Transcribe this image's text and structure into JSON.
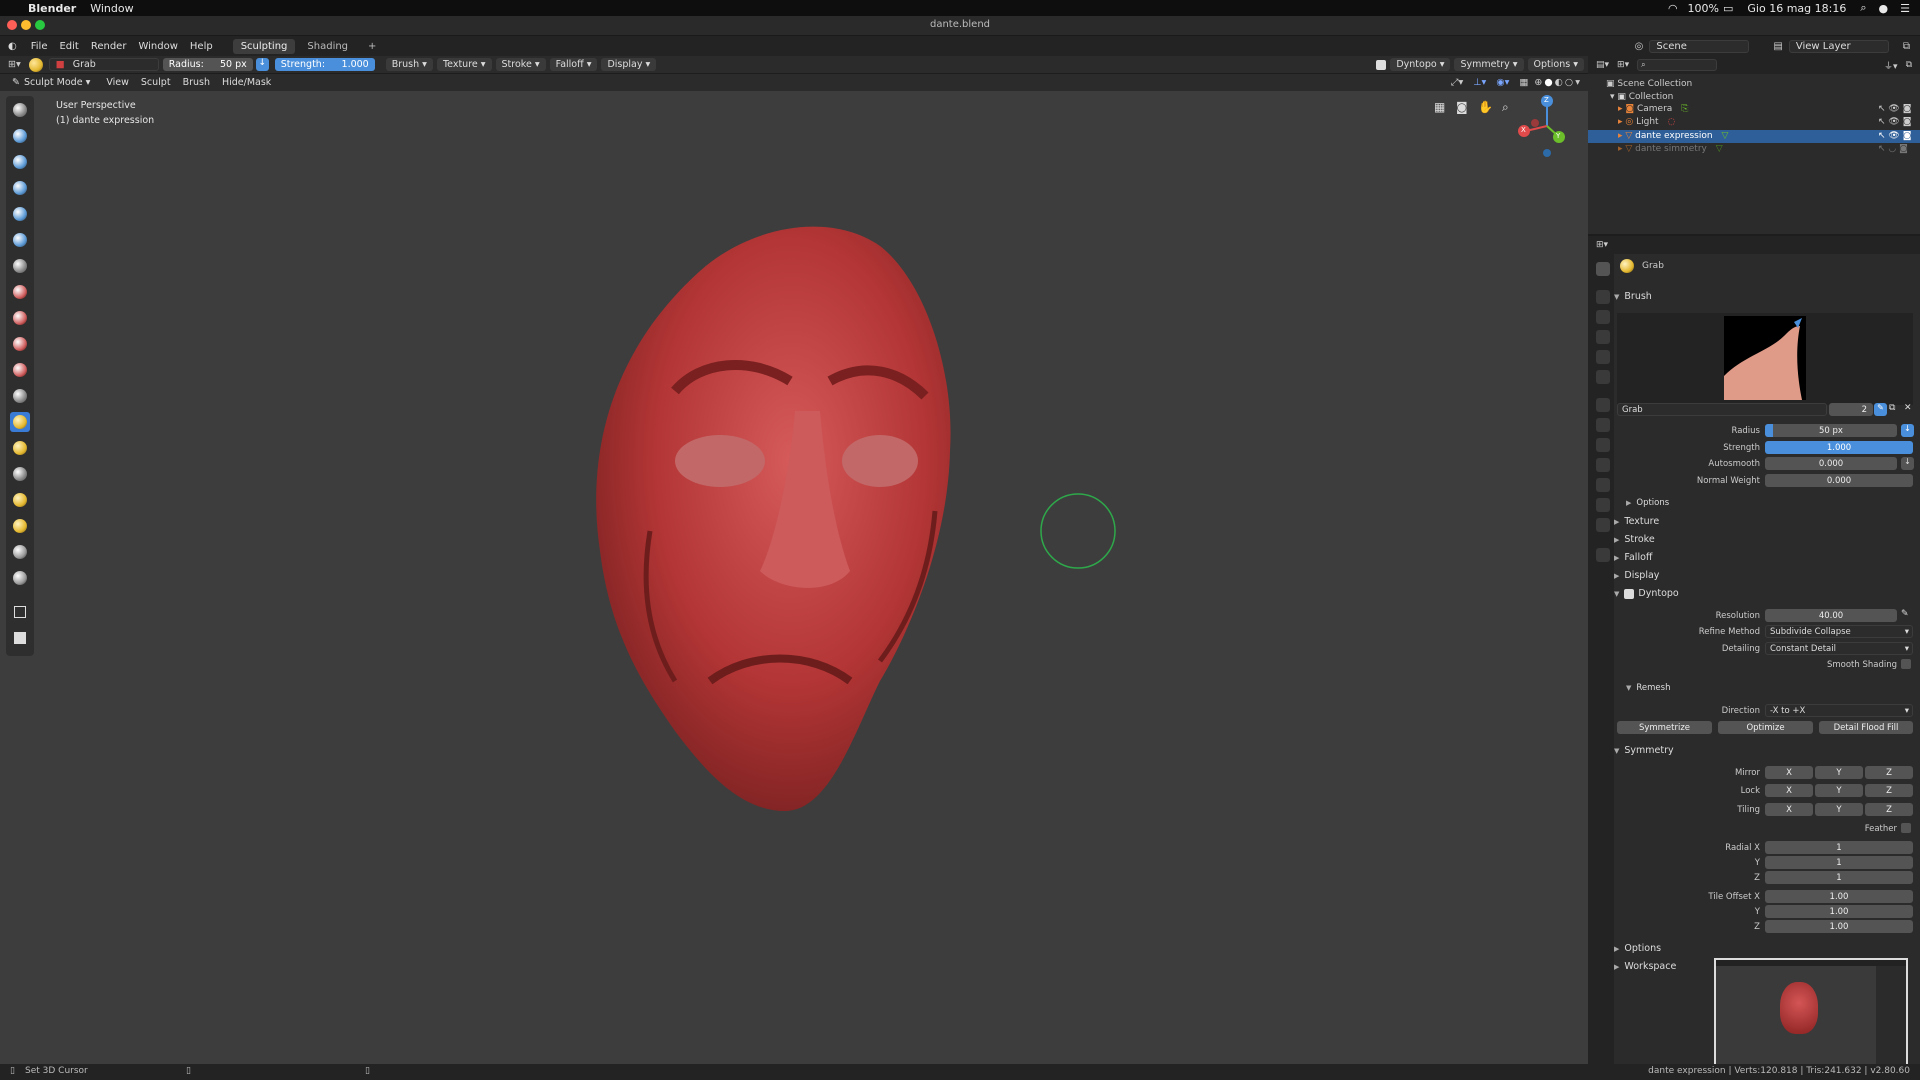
{
  "mac": {
    "app": "Blender",
    "menu": [
      "Window"
    ],
    "battery": "100%",
    "clock": "Gio 16 mag  18:16"
  },
  "window_title": "dante.blend",
  "topmenu": [
    "File",
    "Edit",
    "Render",
    "Window",
    "Help"
  ],
  "workspaces": [
    "Sculpting",
    "Shading"
  ],
  "workspace_add": "+",
  "scene": "Scene",
  "view_layer": "View Layer",
  "tool_header": {
    "brush_name": "Grab",
    "radius_label": "Radius:",
    "radius_value": "50 px",
    "strength_label": "Strength:",
    "strength_value": "1.000",
    "menus": [
      "Brush",
      "Texture",
      "Stroke",
      "Falloff",
      "Display"
    ],
    "dyntopo": "Dyntopo",
    "symmetry": "Symmetry",
    "options": "Options"
  },
  "mode_header": {
    "mode": "Sculpt Mode",
    "menus": [
      "View",
      "Sculpt",
      "Brush",
      "Hide/Mask"
    ]
  },
  "viewport": {
    "perspective": "User Perspective",
    "object": "(1) dante expression",
    "gizmo": {
      "x": "X",
      "y": "Y",
      "z": "Z"
    }
  },
  "outliner": {
    "root": "Scene Collection",
    "collection": "Collection",
    "items": [
      {
        "name": "Camera",
        "color": "#e8833a"
      },
      {
        "name": "Light",
        "color": "#e8833a"
      },
      {
        "name": "dante expression",
        "color": "#e8833a",
        "selected": true
      },
      {
        "name": "dante simmetry",
        "color": "#e8833a",
        "dim": true
      }
    ]
  },
  "props": {
    "tool_name": "Grab",
    "brush_section": "Brush",
    "brush_slot": "Grab",
    "brush_users": "2",
    "radius_label": "Radius",
    "radius": "50 px",
    "strength_label": "Strength",
    "strength": "1.000",
    "autosmooth_label": "Autosmooth",
    "autosmooth": "0.000",
    "normal_weight_label": "Normal Weight",
    "normal_weight": "0.000",
    "options": "Options",
    "texture": "Texture",
    "stroke": "Stroke",
    "falloff": "Falloff",
    "display": "Display",
    "dyntopo": "Dyntopo",
    "resolution_label": "Resolution",
    "resolution": "40.00",
    "refine_label": "Refine Method",
    "refine": "Subdivide Collapse",
    "detailing_label": "Detailing",
    "detailing": "Constant Detail",
    "smooth_shading": "Smooth Shading",
    "remesh": "Remesh",
    "direction_label": "Direction",
    "direction": "-X to +X",
    "symmetrize": "Symmetrize",
    "optimize": "Optimize",
    "flood_fill": "Detail Flood Fill",
    "symmetry": "Symmetry",
    "mirror_label": "Mirror",
    "lock_label": "Lock",
    "tiling_label": "Tiling",
    "axes": [
      "X",
      "Y",
      "Z"
    ],
    "feather": "Feather",
    "radial_x_label": "Radial X",
    "radial_y_label": "Y",
    "radial_z_label": "Z",
    "radial": [
      "1",
      "1",
      "1"
    ],
    "tile_x_label": "Tile Offset X",
    "tile_y_label": "Y",
    "tile_z_label": "Z",
    "tile_offset": [
      "1.00",
      "1.00",
      "1.00"
    ],
    "options2": "Options",
    "workspace": "Workspace"
  },
  "status": {
    "left": "Set 3D Cursor",
    "right": "dante expression | Verts:120.818 | Tris:241.632 | v2.80.60"
  },
  "colors": {
    "accent": "#4a8fdb",
    "head": "#b83a3a",
    "cursor_ring": "#2ea84a"
  }
}
